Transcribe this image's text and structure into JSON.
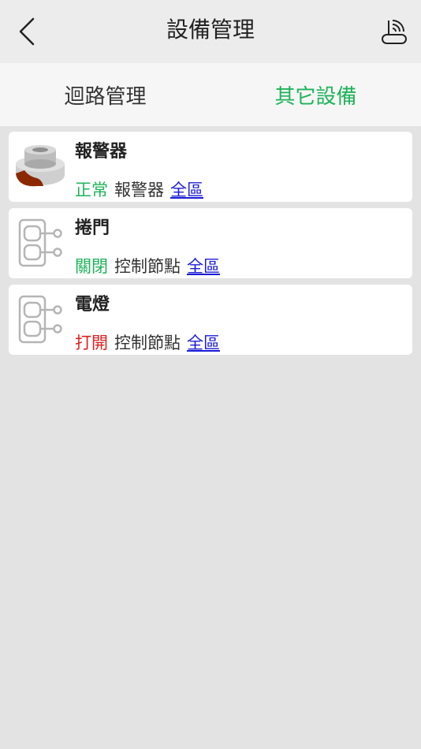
{
  "header": {
    "title": "設備管理",
    "back_icon": "chevron-left-icon",
    "right_icon": "router-wifi-icon"
  },
  "tabs": [
    {
      "label": "迴路管理",
      "active": false
    },
    {
      "label": "其它設備",
      "active": true
    }
  ],
  "colors": {
    "accent_green": "#1fb35a",
    "status_red": "#e02020",
    "zone_blue": "#1a1ad6"
  },
  "devices": [
    {
      "name": "報警器",
      "icon": "alarm-siren-icon",
      "status": "正常",
      "status_color": "#1fb35a",
      "type": "報警器",
      "zone": "全區"
    },
    {
      "name": "捲門",
      "icon": "control-node-icon",
      "status": "關閉",
      "status_color": "#1fb35a",
      "type": "控制節點",
      "zone": "全區"
    },
    {
      "name": "電燈",
      "icon": "control-node-icon",
      "status": "打開",
      "status_color": "#e02020",
      "type": "控制節點",
      "zone": "全區"
    }
  ]
}
